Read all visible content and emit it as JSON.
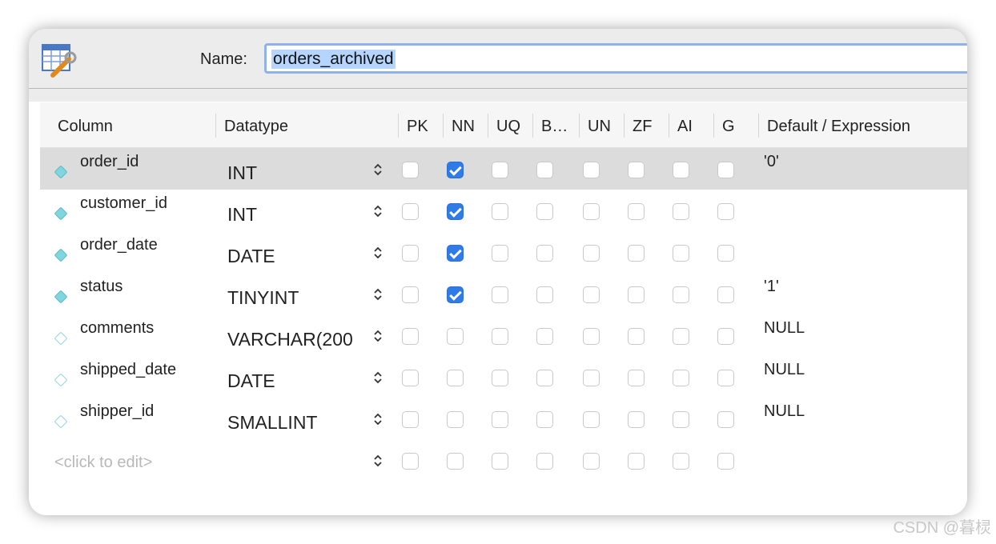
{
  "header": {
    "name_label": "Name:",
    "name_value": "orders_archived"
  },
  "columns_header": {
    "column": "Column",
    "datatype": "Datatype",
    "flags": [
      "PK",
      "NN",
      "UQ",
      "B…",
      "UN",
      "ZF",
      "AI",
      "G"
    ],
    "default": "Default / Expression"
  },
  "rows": [
    {
      "name": "order_id",
      "datatype": "INT",
      "flags": [
        false,
        true,
        false,
        false,
        false,
        false,
        false,
        false
      ],
      "default": "'0'",
      "selected": true
    },
    {
      "name": "customer_id",
      "datatype": "INT",
      "flags": [
        false,
        true,
        false,
        false,
        false,
        false,
        false,
        false
      ],
      "default": ""
    },
    {
      "name": "order_date",
      "datatype": "DATE",
      "flags": [
        false,
        true,
        false,
        false,
        false,
        false,
        false,
        false
      ],
      "default": ""
    },
    {
      "name": "status",
      "datatype": "TINYINT",
      "flags": [
        false,
        true,
        false,
        false,
        false,
        false,
        false,
        false
      ],
      "default": "'1'"
    },
    {
      "name": "comments",
      "datatype": "VARCHAR(200",
      "flags": [
        false,
        false,
        false,
        false,
        false,
        false,
        false,
        false
      ],
      "default": "NULL"
    },
    {
      "name": "shipped_date",
      "datatype": "DATE",
      "flags": [
        false,
        false,
        false,
        false,
        false,
        false,
        false,
        false
      ],
      "default": "NULL"
    },
    {
      "name": "shipper_id",
      "datatype": "SMALLINT",
      "flags": [
        false,
        false,
        false,
        false,
        false,
        false,
        false,
        false
      ],
      "default": "NULL"
    }
  ],
  "new_row_placeholder": "<click to edit>",
  "watermark": "CSDN @暮棂",
  "colors": {
    "checkbox_checked": "#2f7ce8",
    "selected_row": "#dcdcdc",
    "name_highlight": "#b5d5ff",
    "input_focus_border": "#8fb2ea",
    "diamond": "#7fd6df"
  },
  "icons": {
    "window": "table-edit-icon",
    "column": "diamond-icon",
    "stepper": "up-down-chevron-icon"
  }
}
